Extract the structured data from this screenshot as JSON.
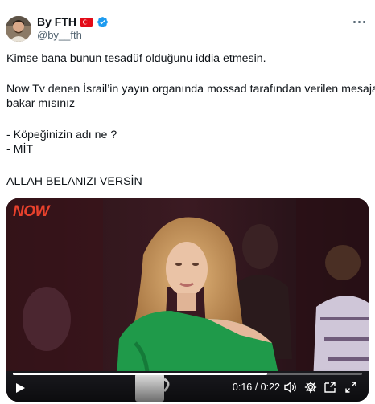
{
  "author": {
    "display_name": "By FTH",
    "handle": "@by__fth",
    "avatar_icon": "profile-photo",
    "flag_icon": "turkey-flag-icon",
    "verified_icon": "verified-badge-icon",
    "verified_color": "#1d9bf0"
  },
  "menu": {
    "more_icon": "more-horizontal-icon"
  },
  "tweet": {
    "lines": [
      "Kimse bana bunun tesadüf olduğunu iddia etmesin.",
      "Now Tv denen İsrail’in yayın organında mossad tarafından verilen mesaja",
      "bakar mısınız",
      "- Köpeğinizin adı ne ?",
      "- MİT",
      "ALLAH BELANIZI VERSİN"
    ]
  },
  "video": {
    "channel_logo": "NOW",
    "time_display": "0:16 / 0:22",
    "progress_fraction": 0.727,
    "icons": {
      "play": "play-icon",
      "volume": "volume-icon",
      "settings": "settings-gear-icon",
      "pip": "picture-in-picture-icon",
      "fullscreen": "fullscreen-icon"
    }
  },
  "colors": {
    "text": "#0f1419",
    "secondary": "#536471",
    "flag_red": "#e30a17",
    "logo_red": "#e8412c"
  }
}
